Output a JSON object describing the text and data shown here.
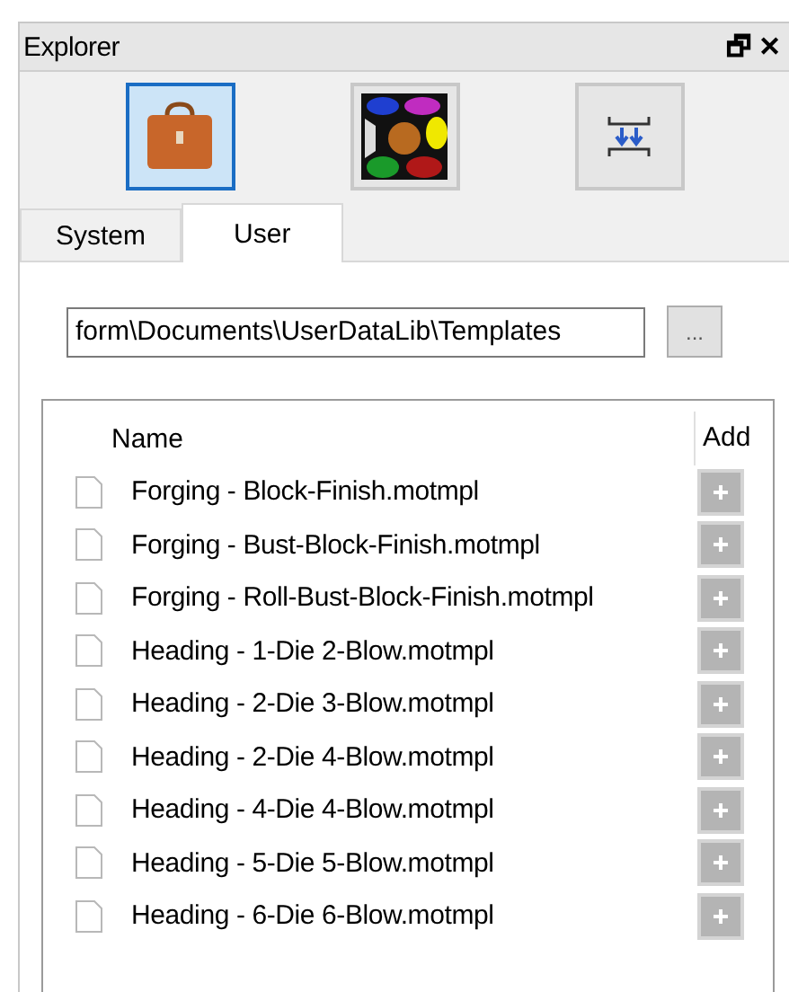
{
  "window": {
    "title": "Explorer",
    "float_glyph": "🗗",
    "close_glyph": "✕"
  },
  "toolbar": [
    {
      "kind": "briefcase",
      "selected": true
    },
    {
      "kind": "palette",
      "selected": false
    },
    {
      "kind": "press",
      "selected": false
    }
  ],
  "tabs": [
    {
      "label": "System",
      "selected": false
    },
    {
      "label": "User",
      "selected": true
    }
  ],
  "path": {
    "value": "form\\Documents\\UserDataLib\\Templates",
    "browse_label": "..."
  },
  "list": {
    "columns": [
      "Name",
      "Add"
    ],
    "rows": [
      {
        "name": "Forging - Block-Finish.motmpl"
      },
      {
        "name": "Forging - Bust-Block-Finish.motmpl"
      },
      {
        "name": "Forging - Roll-Bust-Block-Finish.motmpl"
      },
      {
        "name": "Heading - 1-Die 2-Blow.motmpl"
      },
      {
        "name": "Heading - 2-Die 3-Blow.motmpl"
      },
      {
        "name": "Heading - 2-Die 4-Blow.motmpl"
      },
      {
        "name": "Heading - 4-Die 4-Blow.motmpl"
      },
      {
        "name": "Heading - 5-Die 5-Blow.motmpl"
      },
      {
        "name": "Heading - 6-Die 6-Blow.motmpl"
      }
    ]
  }
}
